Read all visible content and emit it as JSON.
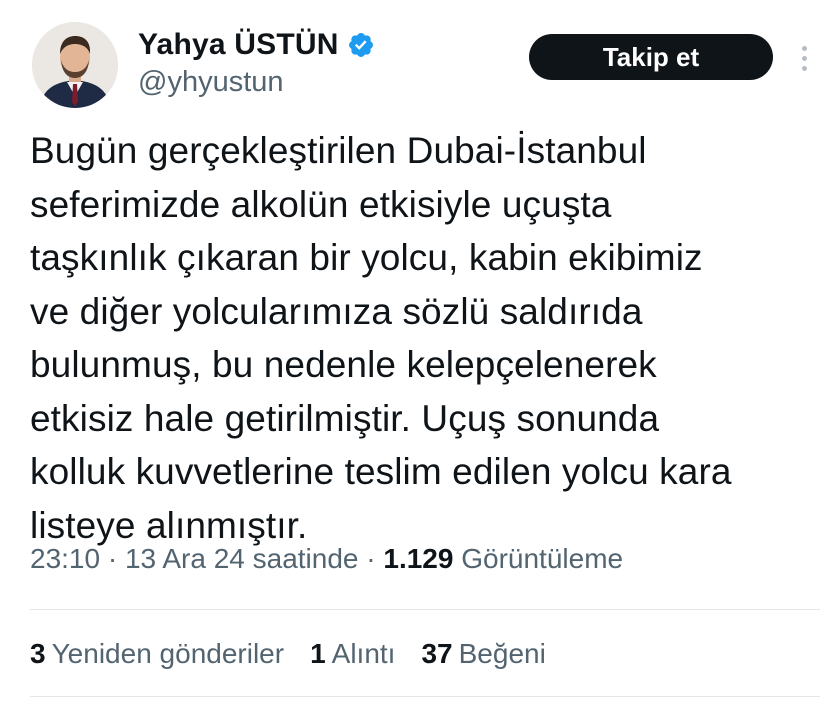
{
  "author": {
    "display_name": "Yahya ÜSTÜN",
    "handle": "@yhyustun",
    "verified": true,
    "verified_color": "#1d9bf0"
  },
  "actions": {
    "follow_label": "Takip et"
  },
  "tweet": {
    "text": "Bugün gerçekleştirilen Dubai-İstanbul\nseferimizde alkolün etkisiyle uçuşta\ntaşkınlık çıkaran bir yolcu, kabin ekibimiz\nve diğer yolcularımıza sözlü saldırıda\nbulunmuş, bu nedenle kelepçelenerek\netkisiz hale getirilmiştir. Uçuş sonunda\nkolluk kuvvetlerine teslim edilen yolcu kara\nlisteye alınmıştır."
  },
  "meta": {
    "time": "23:10",
    "separator": " · ",
    "date": "13 Ara 24 saatinde",
    "views_count": "1.129",
    "views_label": "Görüntüleme"
  },
  "stats": {
    "retweets_count": "3",
    "retweets_label": "Yeniden gönderiler",
    "quotes_count": "1",
    "quotes_label": "Alıntı",
    "likes_count": "37",
    "likes_label": "Beğeni"
  }
}
